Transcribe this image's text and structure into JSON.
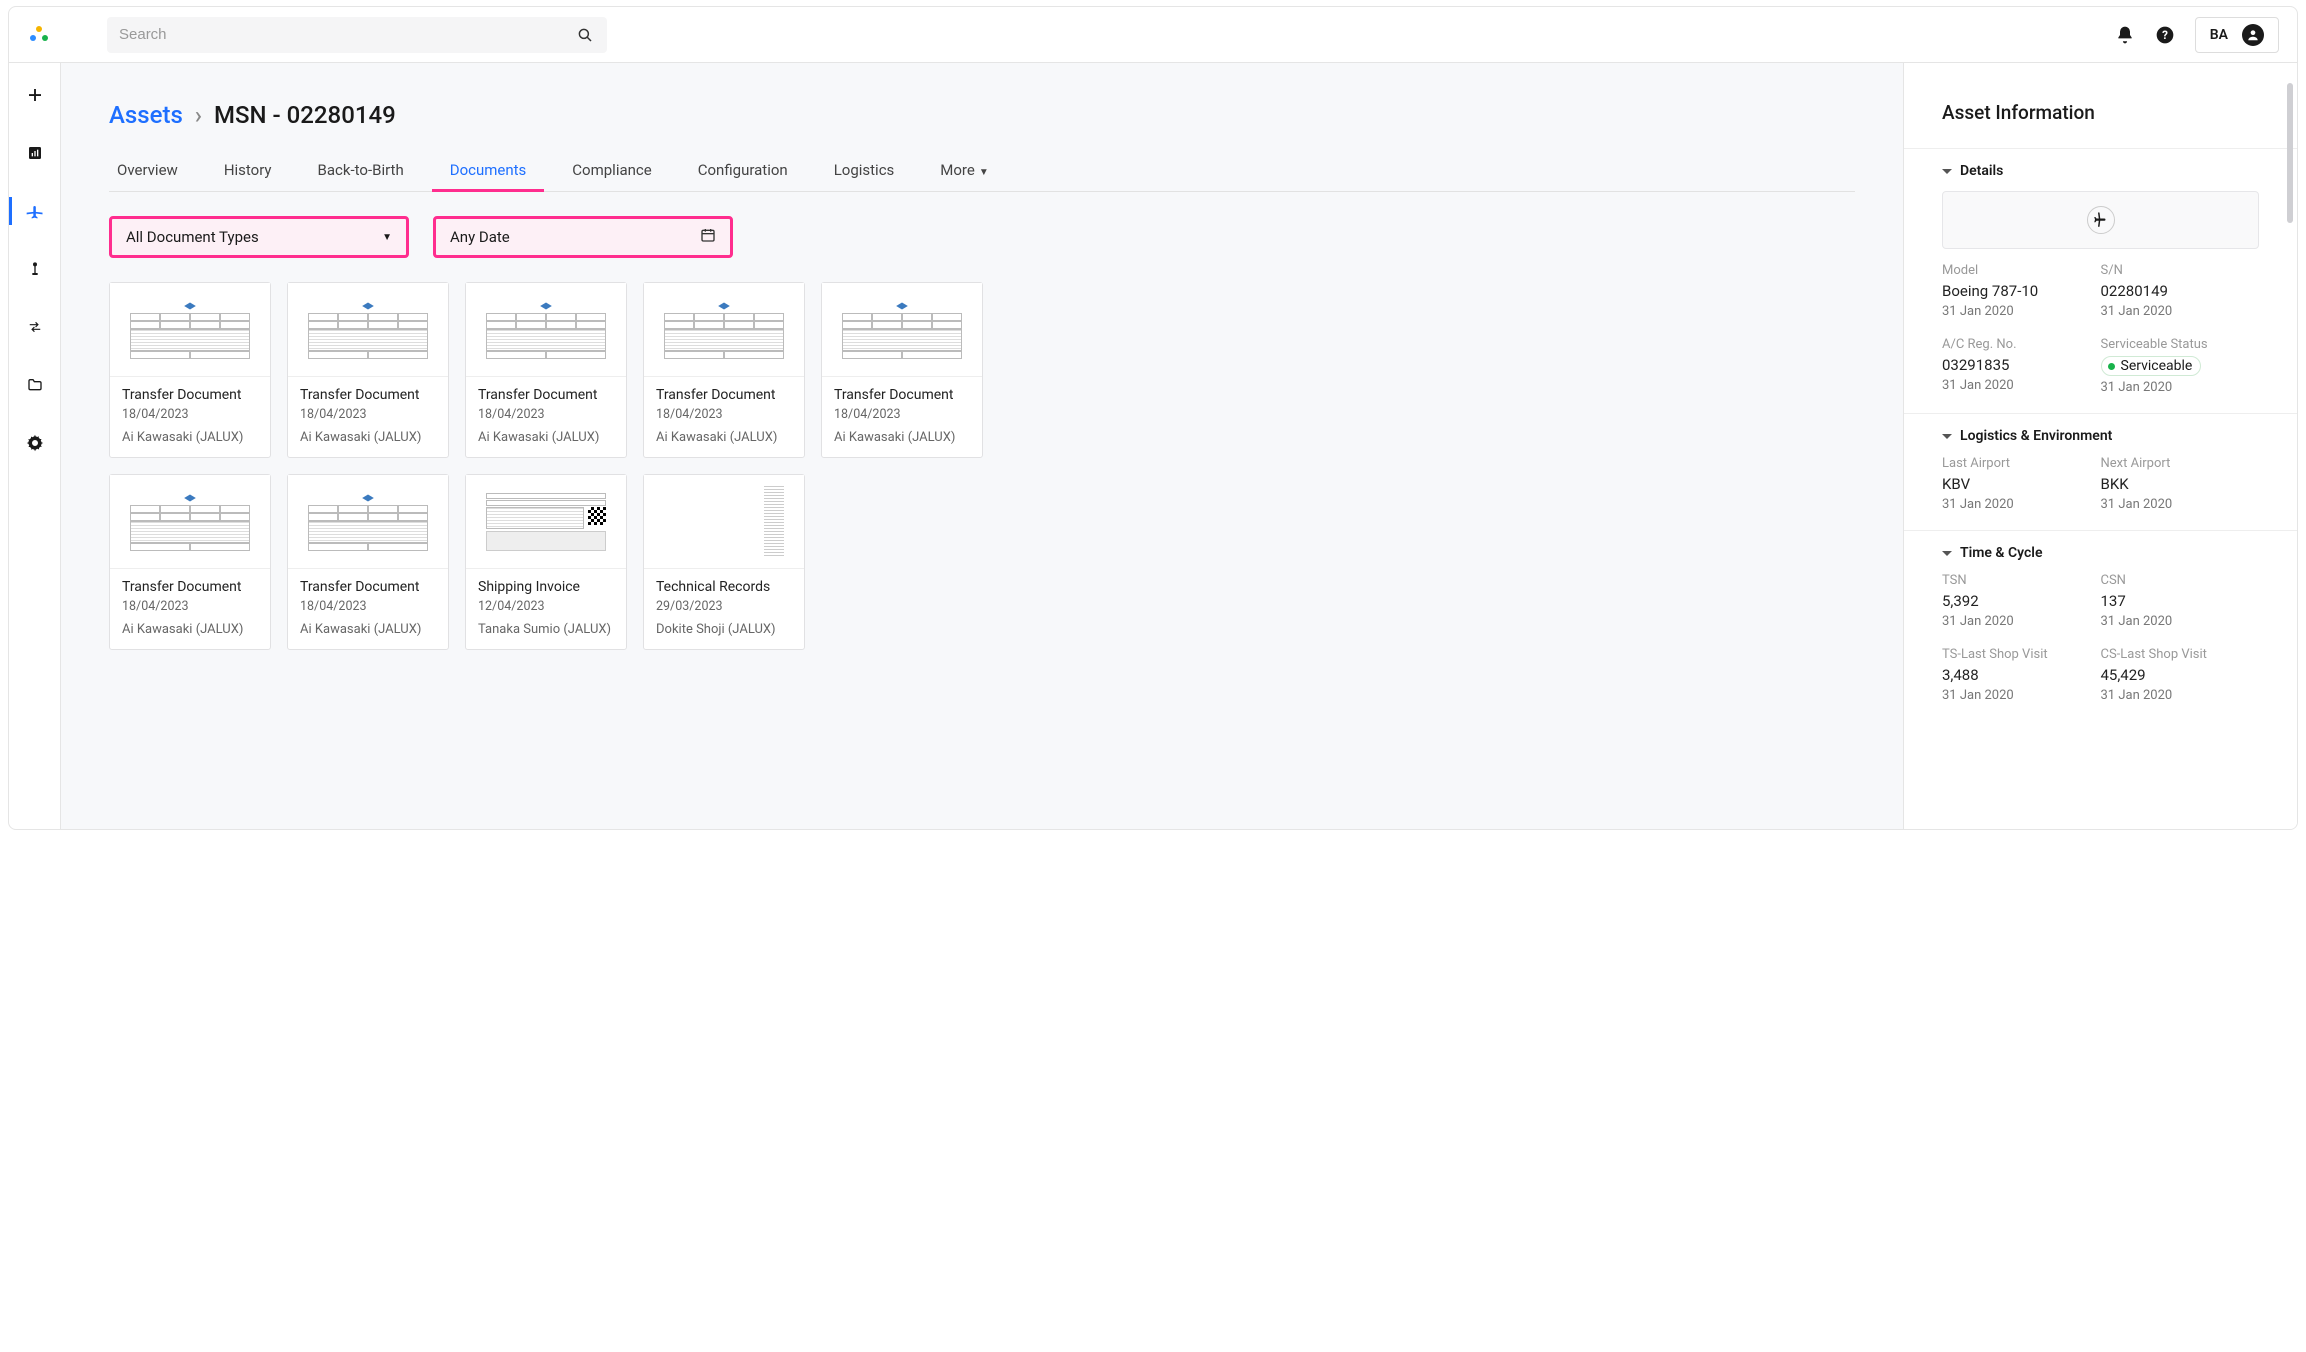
{
  "header": {
    "search_placeholder": "Search",
    "user_initials": "BA"
  },
  "breadcrumb": {
    "root": "Assets",
    "current": "MSN - 02280149"
  },
  "tabs": [
    {
      "id": "overview",
      "label": "Overview"
    },
    {
      "id": "history",
      "label": "History"
    },
    {
      "id": "b2b",
      "label": "Back-to-Birth"
    },
    {
      "id": "documents",
      "label": "Documents",
      "active": true
    },
    {
      "id": "compliance",
      "label": "Compliance"
    },
    {
      "id": "configuration",
      "label": "Configuration"
    },
    {
      "id": "logistics",
      "label": "Logistics"
    },
    {
      "id": "more",
      "label": "More",
      "hasChevron": true
    }
  ],
  "filters": {
    "doc_type_label": "All Document Types",
    "date_label": "Any Date"
  },
  "documents": [
    {
      "title": "Transfer Document",
      "date": "18/04/2023",
      "owner": "Ai Kawasaki (JALUX)",
      "thumb": "form"
    },
    {
      "title": "Transfer Document",
      "date": "18/04/2023",
      "owner": "Ai Kawasaki (JALUX)",
      "thumb": "form"
    },
    {
      "title": "Transfer Document",
      "date": "18/04/2023",
      "owner": "Ai Kawasaki (JALUX)",
      "thumb": "form"
    },
    {
      "title": "Transfer Document",
      "date": "18/04/2023",
      "owner": "Ai Kawasaki (JALUX)",
      "thumb": "form"
    },
    {
      "title": "Transfer Document",
      "date": "18/04/2023",
      "owner": "Ai Kawasaki (JALUX)",
      "thumb": "form"
    },
    {
      "title": "Transfer Document",
      "date": "18/04/2023",
      "owner": "Ai Kawasaki (JALUX)",
      "thumb": "form"
    },
    {
      "title": "Transfer Document",
      "date": "18/04/2023",
      "owner": "Ai Kawasaki (JALUX)",
      "thumb": "form"
    },
    {
      "title": "Shipping Invoice",
      "date": "12/04/2023",
      "owner": "Tanaka Sumio (JALUX)",
      "thumb": "invoice"
    },
    {
      "title": "Technical Records",
      "date": "29/03/2023",
      "owner": "Dokite Shoji (JALUX)",
      "thumb": "tech"
    }
  ],
  "asset_info": {
    "panel_title": "Asset Information",
    "sections": {
      "details": {
        "title": "Details",
        "model": {
          "label": "Model",
          "value": "Boeing 787-10",
          "date": "31 Jan 2020"
        },
        "sn": {
          "label": "S/N",
          "value": "02280149",
          "date": "31 Jan 2020"
        },
        "reg": {
          "label": "A/C Reg. No.",
          "value": "03291835",
          "date": "31 Jan 2020"
        },
        "status": {
          "label": "Serviceable Status",
          "value": "Serviceable",
          "date": "31 Jan 2020"
        }
      },
      "logistics": {
        "title": "Logistics & Environment",
        "last_airport": {
          "label": "Last Airport",
          "value": "KBV",
          "date": "31 Jan 2020"
        },
        "next_airport": {
          "label": "Next Airport",
          "value": "BKK",
          "date": "31 Jan 2020"
        }
      },
      "timecycle": {
        "title": "Time & Cycle",
        "tsn": {
          "label": "TSN",
          "value": "5,392",
          "date": "31 Jan 2020"
        },
        "csn": {
          "label": "CSN",
          "value": "137",
          "date": "31 Jan 2020"
        },
        "tslsv": {
          "label": "TS-Last Shop Visit",
          "value": "3,488",
          "date": "31 Jan 2020"
        },
        "cslsv": {
          "label": "CS-Last Shop Visit",
          "value": "45,429",
          "date": "31 Jan 2020"
        }
      }
    }
  }
}
